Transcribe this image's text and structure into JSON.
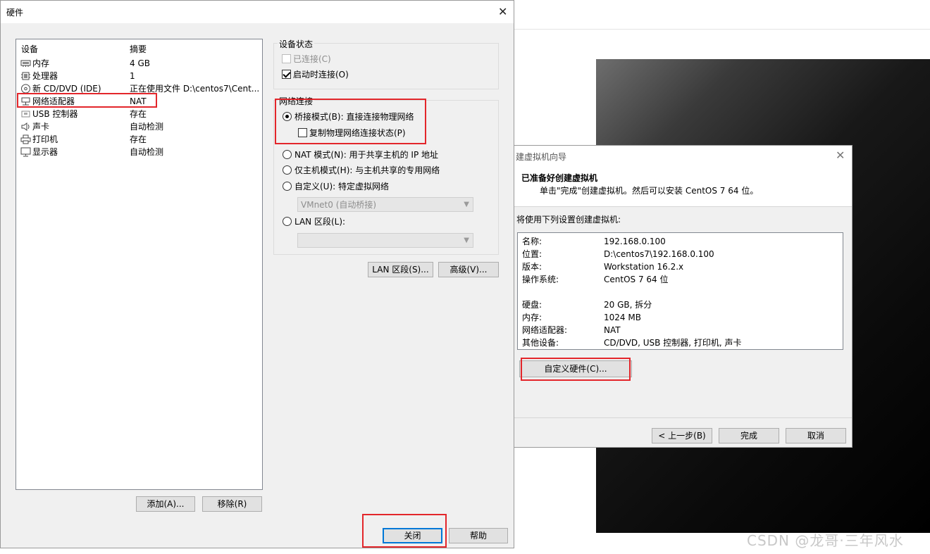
{
  "hardware_dialog": {
    "title": "硬件",
    "device_list": {
      "headers": {
        "device": "设备",
        "summary": "摘要"
      },
      "items": [
        {
          "icon": "memory-icon",
          "name": "内存",
          "summary": "4 GB"
        },
        {
          "icon": "cpu-icon",
          "name": "处理器",
          "summary": "1"
        },
        {
          "icon": "cd-dvd-icon",
          "name": "新 CD/DVD (IDE)",
          "summary": "正在使用文件 D:\\centos7\\Cent..."
        },
        {
          "icon": "network-adapter-icon",
          "name": "网络适配器",
          "summary": "NAT"
        },
        {
          "icon": "usb-icon",
          "name": "USB 控制器",
          "summary": "存在"
        },
        {
          "icon": "speaker-icon",
          "name": "声卡",
          "summary": "自动检测"
        },
        {
          "icon": "printer-icon",
          "name": "打印机",
          "summary": "存在"
        },
        {
          "icon": "monitor-icon",
          "name": "显示器",
          "summary": "自动检测"
        }
      ]
    },
    "device_status": {
      "label": "设备状态",
      "connected": "已连接(C)",
      "connect_on_power_on": "启动时连接(O)"
    },
    "network_connection": {
      "label": "网络连接",
      "bridged": "桥接模式(B): 直接连接物理网络",
      "replicate": "复制物理网络连接状态(P)",
      "nat": "NAT 模式(N): 用于共享主机的 IP 地址",
      "host_only": "仅主机模式(H): 与主机共享的专用网络",
      "custom": "自定义(U): 特定虚拟网络",
      "custom_value": "VMnet0 (自动桥接)",
      "lan_segment": "LAN 区段(L):",
      "lan_value": ""
    },
    "buttons": {
      "lan_segments": "LAN 区段(S)...",
      "advanced": "高级(V)...",
      "add": "添加(A)...",
      "remove": "移除(R)",
      "close": "关闭",
      "help": "帮助"
    }
  },
  "wizard_dialog": {
    "title": "建虚拟机向导",
    "heading": "已准备好创建虚拟机",
    "subheading": "单击\"完成\"创建虚拟机。然后可以安装 CentOS 7 64 位。",
    "intro": "将使用下列设置创建虚拟机:",
    "summary": [
      {
        "key": "名称:",
        "value": "192.168.0.100"
      },
      {
        "key": "位置:",
        "value": "D:\\centos7\\192.168.0.100"
      },
      {
        "key": "版本:",
        "value": "Workstation 16.2.x"
      },
      {
        "key": "操作系统:",
        "value": "CentOS 7 64 位"
      },
      {
        "key": "硬盘:",
        "value": "20 GB, 拆分"
      },
      {
        "key": "内存:",
        "value": "1024 MB"
      },
      {
        "key": "网络适配器:",
        "value": "NAT"
      },
      {
        "key": "其他设备:",
        "value": "CD/DVD, USB 控制器, 打印机, 声卡"
      }
    ],
    "buttons": {
      "customize": "自定义硬件(C)...",
      "back": "< 上一步(B)",
      "finish": "完成",
      "cancel": "取消"
    }
  },
  "watermark": "CSDN @龙哥·三年风水",
  "colors": {
    "highlight": "#e3262b",
    "dialog_bg": "#f0f0f0",
    "focus_blue": "#0078d7"
  }
}
